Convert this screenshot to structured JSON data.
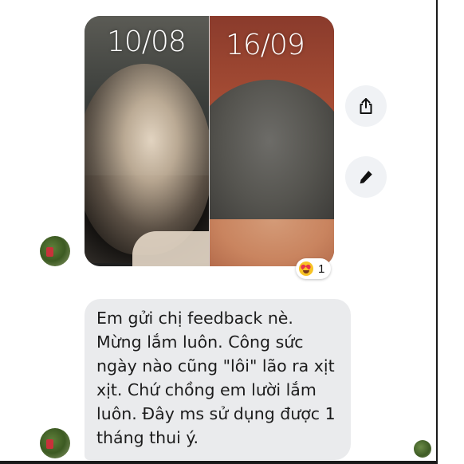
{
  "photo_message": {
    "left_date": "10/08",
    "right_date": "16/09",
    "reaction": {
      "emoji": "heart-eyes",
      "count": "1"
    }
  },
  "actions": {
    "share_icon": "share-icon",
    "edit_icon": "pencil-icon"
  },
  "text_message": {
    "text": "Em gửi chị feedback nè.\nMừng lắm luôn. Công sức\nngày nào cũng \"lôi\" lão ra xịt\nxịt. Chứ chồng em lười lắm\nluôn. Đây ms sử dụng được 1\ntháng thui ý."
  },
  "colors": {
    "bubble": "#eaebed",
    "button": "#f0f2f5",
    "text": "#1c1c1c"
  }
}
